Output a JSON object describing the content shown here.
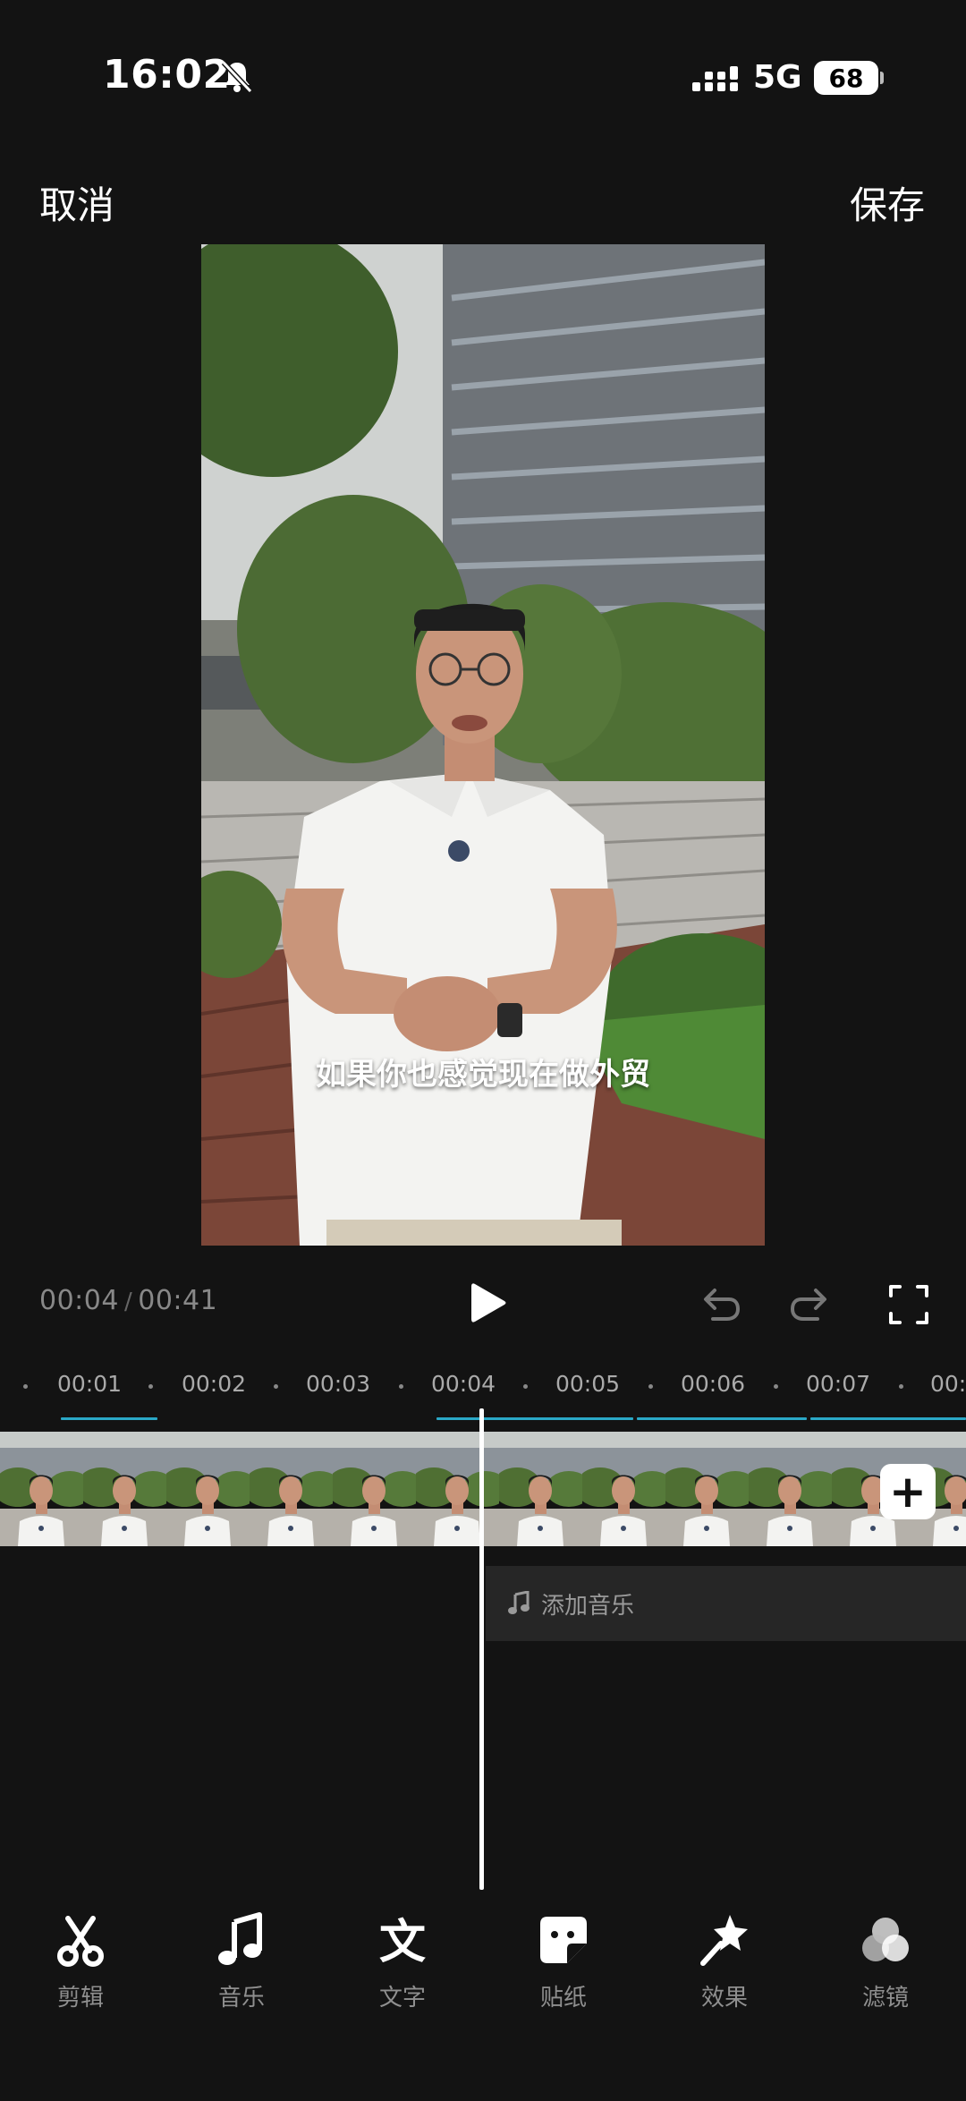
{
  "status": {
    "time": "16:02",
    "network": "5G",
    "battery": "68"
  },
  "header": {
    "cancel": "取消",
    "save": "保存"
  },
  "preview": {
    "subtitle": "如果你也感觉现在做外贸"
  },
  "player": {
    "current": "00:04",
    "separator": "/",
    "total": "00:41"
  },
  "ruler": {
    "labels": [
      "00:01",
      "00:02",
      "00:03",
      "00:04",
      "00:05",
      "00:06",
      "00:07",
      "00:0"
    ]
  },
  "tracks": {
    "add_music": "添加音乐"
  },
  "toolbar": [
    {
      "label": "剪辑",
      "icon": "scissors-icon"
    },
    {
      "label": "音乐",
      "icon": "music-note-icon"
    },
    {
      "label": "文字",
      "icon": "text-icon"
    },
    {
      "label": "贴纸",
      "icon": "sticker-icon"
    },
    {
      "label": "效果",
      "icon": "magic-wand-icon"
    },
    {
      "label": "滤镜",
      "icon": "filter-icon"
    }
  ],
  "colors": {
    "background": "#131313",
    "accent_line": "#2aa8c7",
    "track": "#262626"
  }
}
